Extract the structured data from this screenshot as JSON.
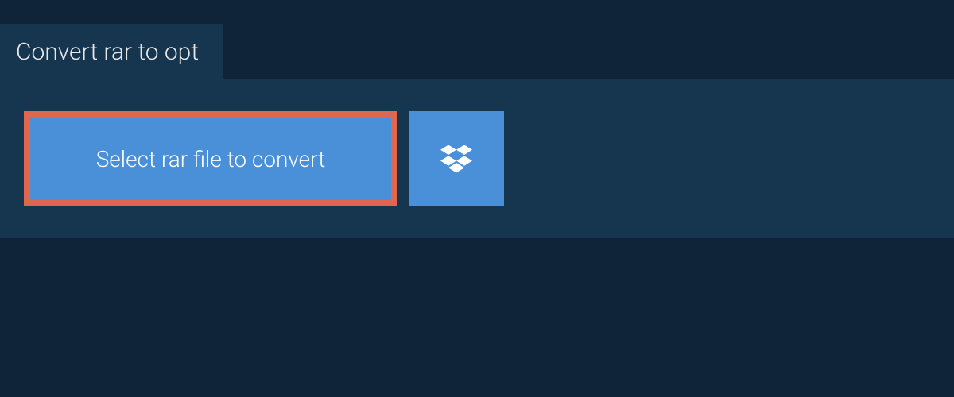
{
  "tab": {
    "title": "Convert rar to opt"
  },
  "actions": {
    "select_file_label": "Select rar file to convert"
  },
  "colors": {
    "page_bg": "#0f2438",
    "panel_bg": "#16354f",
    "button_bg": "#4a90d9",
    "highlight_border": "#e06650",
    "text_light": "#e8e8e8"
  }
}
